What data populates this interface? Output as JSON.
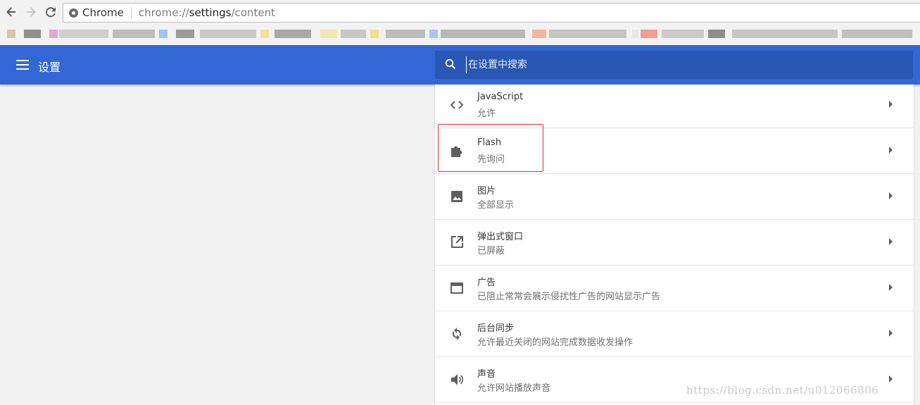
{
  "browser": {
    "tab_chip": "Chrome",
    "url_scheme": "chrome://",
    "url_host": "settings",
    "url_path": "/content"
  },
  "header": {
    "title": "设置",
    "search_placeholder": "在设置中搜索"
  },
  "rows": [
    {
      "title": "JavaScript",
      "subtitle": "允许",
      "icon": "code-icon"
    },
    {
      "title": "Flash",
      "subtitle": "先询问",
      "icon": "puzzle-icon"
    },
    {
      "title": "图片",
      "subtitle": "全部显示",
      "icon": "image-icon"
    },
    {
      "title": "弹出式窗口",
      "subtitle": "已屏蔽",
      "icon": "open-in-new-icon"
    },
    {
      "title": "广告",
      "subtitle": "已阻止常常会展示侵扰性广告的网站显示广告",
      "icon": "window-icon"
    },
    {
      "title": "后台同步",
      "subtitle": "允许最近关闭的网站完成数据收发操作",
      "icon": "sync-icon"
    },
    {
      "title": "声音",
      "subtitle": "允许网站播放声音",
      "icon": "volume-icon"
    }
  ],
  "watermark": "https://blog.csdn.net/u012066806",
  "colors": {
    "header": "#3367d6",
    "search": "#2a56b4",
    "highlight": "#e03030"
  }
}
